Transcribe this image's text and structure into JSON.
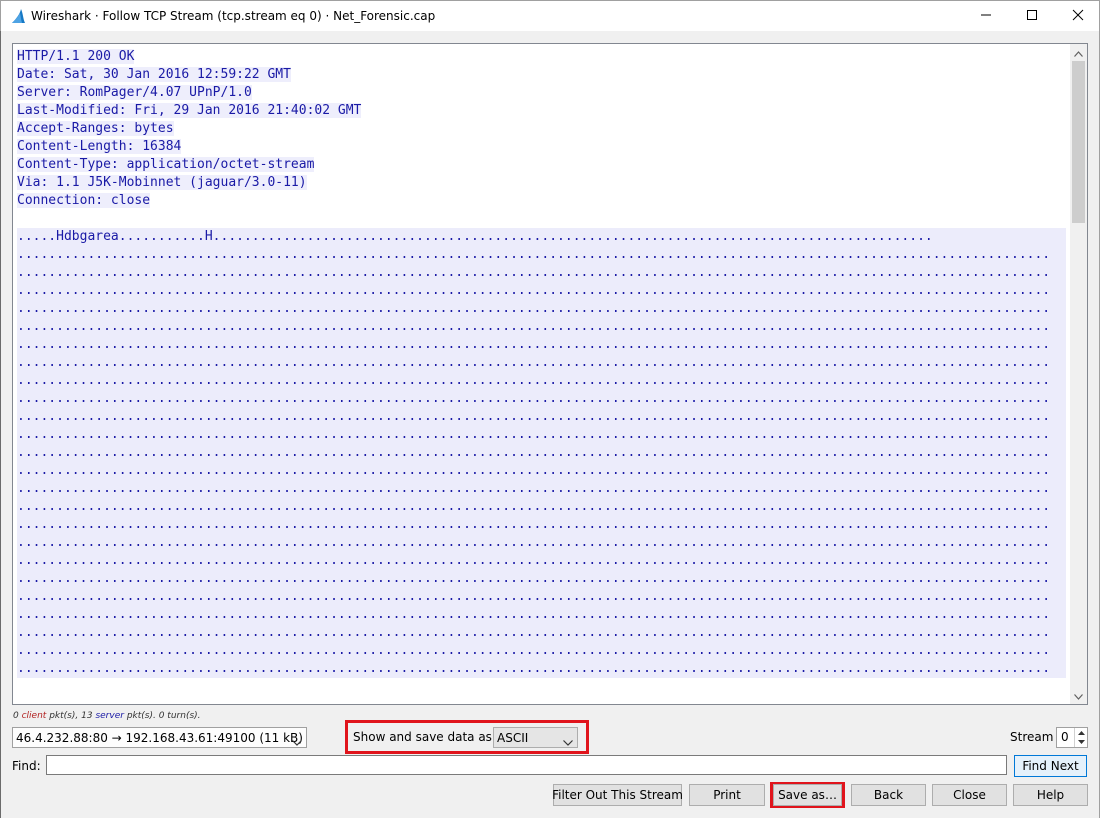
{
  "window": {
    "title": "Wireshark · Follow TCP Stream (tcp.stream eq 0) · Net_Forensic.cap",
    "icons": {
      "app": "wireshark-fin-icon",
      "minimize": "minimize-icon",
      "maximize": "maximize-icon",
      "close": "close-icon"
    }
  },
  "stream": {
    "http_lines": [
      "HTTP/1.1 200 OK",
      "Date: Sat, 30 Jan 2016 12:59:22 GMT",
      "Server: RomPager/4.07 UPnP/1.0",
      "Last-Modified: Fri, 29 Jan 2016 21:40:02 GMT",
      "Accept-Ranges: bytes",
      "Content-Length: 16384",
      "Content-Type: application/octet-stream",
      "Via: 1.1 J5K-Mobinnet (jaguar/3.0-11)",
      "Connection: close"
    ],
    "data_lines": [
      ".....Hdbgarea...........H............................................................................................",
      "....................................................................................................................................",
      "....................................................................................................................................",
      "....................................................................................................................................",
      "....................................................................................................................................",
      "....................................................................................................................................",
      "....................................................................................................................................",
      "....................................................................................................................................",
      "....................................................................................................................................",
      "....................................................................................................................................",
      "....................................................................................................................................",
      "....................................................................................................................................",
      "....................................................................................................................................",
      "....................................................................................................................................",
      "....................................................................................................................................",
      "....................................................................................................................................",
      "....................................................................................................................................",
      "....................................................................................................................................",
      "....................................................................................................................................",
      "....................................................................................................................................",
      "....................................................................................................................................",
      "....................................................................................................................................",
      "....................................................................................................................................",
      "....................................................................................................................................",
      "...................................................................................................................................."
    ],
    "colors": {
      "server_text": "#1a1aa6",
      "server_bg": "#eeeefc",
      "client_text": "#b22222"
    }
  },
  "status": {
    "client_count": "0",
    "client_word": "client",
    "client_suffix": "pkt(s),",
    "server_count": "13",
    "server_word": "server",
    "server_suffix": "pkt(s). 0 turn(s)."
  },
  "controls": {
    "conversation": "46.4.232.88:80 → 192.168.43.61:49100 (11 kB)",
    "show_save_label": "Show and save data as",
    "show_save_value": "ASCII",
    "stream_label": "Stream",
    "stream_value": "0",
    "find_label": "Find:",
    "find_value": "",
    "find_next": "Find Next"
  },
  "buttons": {
    "filter_out": "Filter Out This Stream",
    "print": "Print",
    "save_as": "Save as…",
    "back": "Back",
    "close": "Close",
    "help": "Help"
  },
  "annotations": {
    "highlight_color": "#e0141c"
  }
}
